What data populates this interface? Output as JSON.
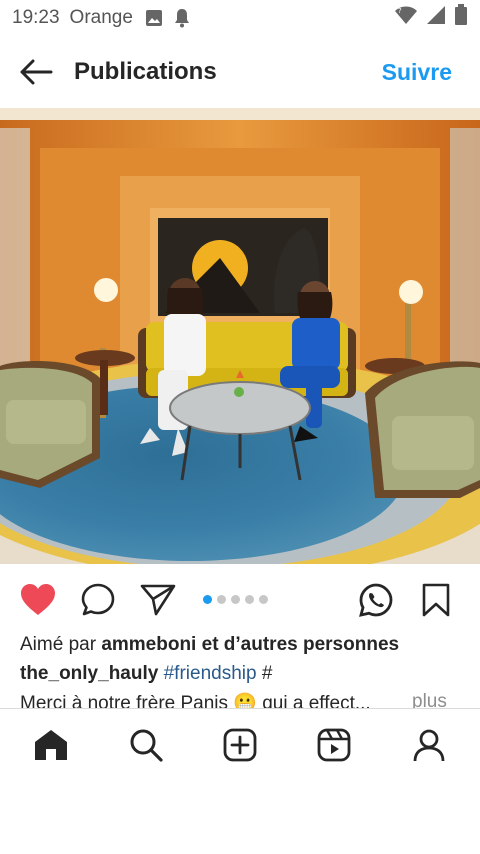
{
  "status_bar": {
    "time": "19:23",
    "carrier": "Orange",
    "icons": [
      "image-icon",
      "notification-bell-icon",
      "wifi-icon",
      "signal-icon",
      "battery-icon"
    ]
  },
  "header": {
    "title": "Publications",
    "follow_label": "Suivre",
    "back_icon": "arrow-left-icon"
  },
  "post": {
    "image_description_icon": "photo",
    "carousel": {
      "total": 5,
      "active_index": 0
    },
    "actions": [
      "heart-icon",
      "comment-icon",
      "share-icon",
      "whatsapp-icon",
      "bookmark-icon"
    ],
    "liked": true,
    "likes_prefix": "Aimé par ",
    "likes_user": "ammeboni",
    "likes_suffix": " et d’autres personnes",
    "caption_user": "the_only_hauly",
    "caption_hashtag": "#friendship",
    "caption_after_hashtag": " #",
    "caption_line2": "Merci à notre frère Panis 😬 qui a effect...",
    "more_label": "plus"
  },
  "bottom_nav": {
    "items": [
      "home-icon",
      "search-icon",
      "create-icon",
      "reels-icon",
      "profile-icon"
    ]
  },
  "colors": {
    "accent": "#1a9af0",
    "like": "#ed4956",
    "text": "#262626"
  }
}
